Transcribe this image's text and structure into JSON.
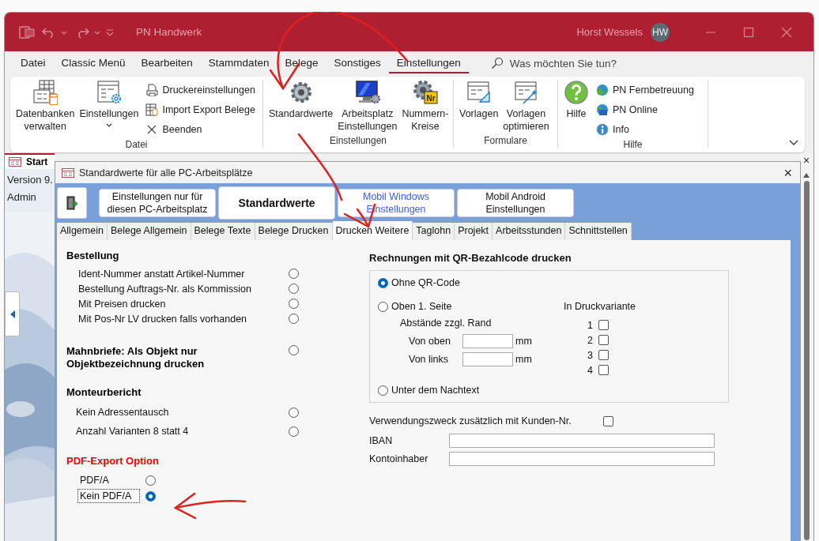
{
  "window": {
    "title": "PN Handwerk",
    "user": "Horst Wessels",
    "avatar": "HW"
  },
  "menu": [
    {
      "label": "Datei",
      "selected": false
    },
    {
      "label": "Classic Menü",
      "selected": false
    },
    {
      "label": "Bearbeiten",
      "selected": false
    },
    {
      "label": "Stammdaten",
      "selected": false
    },
    {
      "label": "Belege",
      "selected": false
    },
    {
      "label": "Sonstiges",
      "selected": false
    },
    {
      "label": "Einstellungen",
      "selected": true
    }
  ],
  "search": {
    "placeholder": "Was möchten Sie tun?"
  },
  "ribbon": {
    "groups": [
      {
        "label": "Datei",
        "items": [
          {
            "kind": "large",
            "label": "Datenbanken\nverwalten"
          },
          {
            "kind": "large",
            "label": "Einstellungen",
            "dropdown": true
          },
          {
            "kind": "small",
            "items": [
              "Druckereinstellungen",
              "Import Export Belege",
              "Beenden"
            ]
          }
        ]
      },
      {
        "label": "Einstellungen",
        "items": [
          {
            "kind": "large",
            "label": "Standardwerte"
          },
          {
            "kind": "large",
            "label": "Arbeitsplatz\nEinstellungen"
          },
          {
            "kind": "large",
            "label": "Nummern-\nKreise",
            "badge": "Nr"
          }
        ]
      },
      {
        "label": "Formulare",
        "items": [
          {
            "kind": "large",
            "label": "Vorlagen"
          },
          {
            "kind": "large",
            "label": "Vorlagen\noptimieren"
          }
        ]
      },
      {
        "label": "Hilfe",
        "items": [
          {
            "kind": "large",
            "label": "Hilfe"
          },
          {
            "kind": "small",
            "items": [
              "PN Fernbetreuung",
              "PN Online",
              "Info"
            ]
          }
        ]
      }
    ]
  },
  "document": {
    "tab": "Start",
    "lines": [
      "Version 9.",
      "Admin"
    ],
    "close": "×"
  },
  "dialog": {
    "title": "Standardwerte für alle PC-Arbeitsplätze",
    "close": "×",
    "mode_buttons": [
      {
        "label": "Einstellungen nur für\ndiesen PC-Arbeitsplatz",
        "kind": "button",
        "selected": false
      },
      {
        "label": "Standardwerte",
        "kind": "button",
        "selected": true
      },
      {
        "label": "Mobil Windows\nEinstellungen",
        "kind": "link",
        "selected": false
      },
      {
        "label": "Mobil Android\nEinstellungen",
        "kind": "button",
        "selected": false
      }
    ],
    "tabs": [
      {
        "label": "Allgemein",
        "selected": false
      },
      {
        "label": "Belege Allgemein",
        "selected": false
      },
      {
        "label": "Belege Texte",
        "selected": false
      },
      {
        "label": "Belege Drucken",
        "selected": false
      },
      {
        "label": "Drucken Weitere",
        "selected": true
      },
      {
        "label": "Taglohn",
        "selected": false
      },
      {
        "label": "Projekt",
        "selected": false
      },
      {
        "label": "Arbeitsstunden",
        "selected": false
      },
      {
        "label": "Schnittstellen",
        "selected": false
      }
    ],
    "left_sections": [
      {
        "kind": "options",
        "title": "Bestellung",
        "color": "#000000",
        "options": [
          {
            "label": "Ident-Nummer anstatt Artikel-Nummer",
            "on": false
          },
          {
            "label": "Bestellung Auftrags-Nr. als Kommission",
            "on": false
          },
          {
            "label": "Mit Preisen drucken",
            "on": false
          },
          {
            "label": "Mit Pos-Nr LV drucken falls vorhanden",
            "on": false
          }
        ]
      },
      {
        "kind": "option_heading",
        "title": "Mahnbriefe: Als Objekt nur\nObjektbezeichnung drucken",
        "color": "#000000",
        "on": false
      },
      {
        "kind": "options",
        "title": "Monteurbericht",
        "color": "#000000",
        "options": [
          {
            "label": "Kein Adressentausch",
            "on": false
          },
          {
            "label": "Anzahl Varianten 8 statt 4",
            "on": false
          }
        ]
      },
      {
        "kind": "radio_group",
        "title": "PDF-Export Option",
        "color": "#ff0000",
        "options": [
          {
            "label": "PDF/A",
            "selected": false,
            "focused": false
          },
          {
            "label": "Kein PDF/A",
            "selected": true,
            "focused": true
          }
        ]
      }
    ],
    "qr": {
      "title": "Rechnungen mit QR-Bezahlcode drucken",
      "options": [
        {
          "label": "Ohne QR-Code",
          "selected": true
        },
        {
          "label": "Oben 1. Seite",
          "selected": false
        },
        {
          "label": "Unter dem Nachtext",
          "selected": false
        }
      ],
      "spacing": {
        "label": "Abstände zzgl. Rand",
        "fields": [
          {
            "label": "Von oben",
            "unit": "mm"
          },
          {
            "label": "Von links",
            "unit": "mm"
          }
        ]
      },
      "variants": {
        "label": "In Druckvariante",
        "items": [
          {
            "number": "1",
            "checked": false
          },
          {
            "number": "2",
            "checked": false
          },
          {
            "number": "3",
            "checked": false
          },
          {
            "number": "4",
            "checked": false
          }
        ]
      }
    },
    "purpose": {
      "label": "Verwendungszweck zusätzlich mit Kunden-Nr.",
      "checked": false
    },
    "bank_fields": [
      {
        "label": "IBAN"
      },
      {
        "label": "Kontoinhaber"
      }
    ]
  }
}
